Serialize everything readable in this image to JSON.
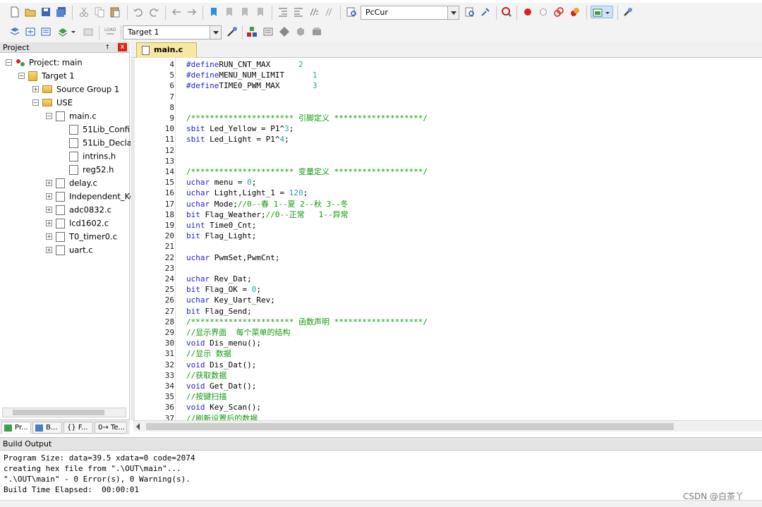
{
  "toolbar1": {
    "target_combo": "PcCur",
    "icons": [
      "new-file-icon",
      "open-file-icon",
      "save-icon",
      "save-all-icon",
      "cut-icon",
      "copy-icon",
      "paste-icon",
      "undo-icon",
      "redo-icon",
      "navigate-back-icon",
      "navigate-forward-icon",
      "bookmark-icon",
      "prev-bookmark-icon",
      "next-bookmark-icon",
      "clear-bookmarks-icon",
      "indent-icon",
      "unindent-icon",
      "comment-icon",
      "uncomment-icon",
      "find-in-files-icon",
      "find-icon",
      "incremental-find-icon",
      "debug-icon",
      "breakpoint-icon",
      "disable-breakpoint-icon",
      "kill-breakpoints-icon",
      "kill-all-breakpoints-icon",
      "window-layout-icon",
      "configure-icon"
    ]
  },
  "toolbar2": {
    "target_select": "Target 1",
    "icons": [
      "translate-icon",
      "build-icon",
      "rebuild-icon",
      "batch-build-icon",
      "stop-build-icon",
      "download-icon",
      "options-for-target-icon",
      "manage-components-icon",
      "file-extensions-icon",
      "select-packs-icon",
      "pack-installer-icon"
    ]
  },
  "project_panel": {
    "title": "Project",
    "pin": "†",
    "close": "x",
    "tree": [
      {
        "label": "Project: main",
        "level": 0,
        "expander": "−",
        "icon": "project-icon"
      },
      {
        "label": "Target 1",
        "level": 1,
        "expander": "−",
        "icon": "target-icon"
      },
      {
        "label": "Source Group 1",
        "level": 2,
        "expander": "+",
        "icon": "folder-icon"
      },
      {
        "label": "USE",
        "level": 2,
        "expander": "−",
        "icon": "folder-icon"
      },
      {
        "label": "main.c",
        "level": 3,
        "expander": "−",
        "icon": "c-file-icon"
      },
      {
        "label": "51Lib_Confi",
        "level": 4,
        "expander": "",
        "icon": "header-file-icon"
      },
      {
        "label": "51Lib_Decla",
        "level": 4,
        "expander": "",
        "icon": "header-file-icon"
      },
      {
        "label": "intrins.h",
        "level": 4,
        "expander": "",
        "icon": "header-file-icon"
      },
      {
        "label": "reg52.h",
        "level": 4,
        "expander": "",
        "icon": "header-file-icon"
      },
      {
        "label": "delay.c",
        "level": 3,
        "expander": "+",
        "icon": "c-file-icon"
      },
      {
        "label": "Independent_Ke",
        "level": 3,
        "expander": "+",
        "icon": "c-file-icon"
      },
      {
        "label": "adc0832.c",
        "level": 3,
        "expander": "+",
        "icon": "c-file-icon"
      },
      {
        "label": "lcd1602.c",
        "level": 3,
        "expander": "+",
        "icon": "c-file-icon"
      },
      {
        "label": "T0_timer0.c",
        "level": 3,
        "expander": "+",
        "icon": "c-file-icon"
      },
      {
        "label": "uart.c",
        "level": 3,
        "expander": "+",
        "icon": "c-file-icon"
      }
    ],
    "tabs": [
      "Pr...",
      "B...",
      "{} F...",
      "0→ Te..."
    ]
  },
  "editor": {
    "tab_label": "main.c",
    "lines": [
      {
        "n": "4",
        "parts": [
          [
            "kw",
            "#define"
          ],
          [
            "",
            "RUN_CNT_MAX      "
          ],
          [
            "num",
            "2"
          ]
        ]
      },
      {
        "n": "5",
        "parts": [
          [
            "kw",
            "#define"
          ],
          [
            "",
            "MENU_NUM_LIMIT      "
          ],
          [
            "num",
            "1"
          ]
        ]
      },
      {
        "n": "6",
        "parts": [
          [
            "kw",
            "#define"
          ],
          [
            "",
            "TIME0_PWM_MAX       "
          ],
          [
            "num",
            "3"
          ]
        ]
      },
      {
        "n": "7",
        "parts": []
      },
      {
        "n": "8",
        "parts": []
      },
      {
        "n": "9",
        "parts": [
          [
            "cm",
            "/********************** 引脚定义 *******************/"
          ]
        ]
      },
      {
        "n": "10",
        "parts": [
          [
            "kw",
            "sbit"
          ],
          [
            "",
            " Led_Yellow = P1^"
          ],
          [
            "num",
            "3"
          ],
          [
            "",
            ";"
          ]
        ]
      },
      {
        "n": "11",
        "parts": [
          [
            "kw",
            "sbit"
          ],
          [
            "",
            " Led_Light = P1^"
          ],
          [
            "num",
            "4"
          ],
          [
            "",
            ";"
          ]
        ]
      },
      {
        "n": "12",
        "parts": []
      },
      {
        "n": "13",
        "parts": []
      },
      {
        "n": "14",
        "parts": [
          [
            "cm",
            "/********************** 变量定义 *******************/"
          ]
        ]
      },
      {
        "n": "15",
        "parts": [
          [
            "kw",
            "uchar"
          ],
          [
            "",
            " menu = "
          ],
          [
            "num",
            "0"
          ],
          [
            "",
            ";"
          ]
        ]
      },
      {
        "n": "16",
        "parts": [
          [
            "kw",
            "uchar"
          ],
          [
            "",
            " Light,Light_1 = "
          ],
          [
            "num",
            "120"
          ],
          [
            "",
            ";"
          ]
        ]
      },
      {
        "n": "17",
        "parts": [
          [
            "kw",
            "uchar"
          ],
          [
            "",
            " Mode;"
          ],
          [
            "cm",
            "//0--春 1--夏 2--秋 3--冬"
          ]
        ]
      },
      {
        "n": "18",
        "parts": [
          [
            "kw",
            "bit"
          ],
          [
            "",
            " Flag_Weather;"
          ],
          [
            "cm",
            "//0--正常   1--异常"
          ]
        ]
      },
      {
        "n": "19",
        "parts": [
          [
            "kw",
            "uint"
          ],
          [
            "",
            " Time0_Cnt;"
          ]
        ]
      },
      {
        "n": "20",
        "parts": [
          [
            "kw",
            "bit"
          ],
          [
            "",
            " Flag_Light;"
          ]
        ]
      },
      {
        "n": "21",
        "parts": []
      },
      {
        "n": "22",
        "parts": [
          [
            "kw",
            "uchar"
          ],
          [
            "",
            " PwmSet,PwmCnt;"
          ]
        ]
      },
      {
        "n": "23",
        "parts": []
      },
      {
        "n": "24",
        "parts": [
          [
            "kw",
            "uchar"
          ],
          [
            "",
            " Rev_Dat;"
          ]
        ]
      },
      {
        "n": "25",
        "parts": [
          [
            "kw",
            "bit"
          ],
          [
            "",
            " Flag_OK = "
          ],
          [
            "num",
            "0"
          ],
          [
            "",
            ";"
          ]
        ]
      },
      {
        "n": "26",
        "parts": [
          [
            "kw",
            "uchar"
          ],
          [
            "",
            " Key_Uart_Rev;"
          ]
        ]
      },
      {
        "n": "27",
        "parts": [
          [
            "kw",
            "bit"
          ],
          [
            "",
            " Flag_Send;"
          ]
        ]
      },
      {
        "n": "28",
        "parts": [
          [
            "cm",
            "/********************** 函数声明 *******************/"
          ]
        ]
      },
      {
        "n": "29",
        "parts": [
          [
            "cm",
            "//显示界面  每个菜单的结构"
          ]
        ]
      },
      {
        "n": "30",
        "parts": [
          [
            "kw",
            "void"
          ],
          [
            "",
            " Dis_menu();"
          ]
        ]
      },
      {
        "n": "31",
        "parts": [
          [
            "cm",
            "//显示 数据"
          ]
        ]
      },
      {
        "n": "32",
        "parts": [
          [
            "kw",
            "void"
          ],
          [
            "",
            " Dis_Dat();"
          ]
        ]
      },
      {
        "n": "33",
        "parts": [
          [
            "cm",
            "//获取数据"
          ]
        ]
      },
      {
        "n": "34",
        "parts": [
          [
            "kw",
            "void"
          ],
          [
            "",
            " Get_Dat();"
          ]
        ]
      },
      {
        "n": "35",
        "parts": [
          [
            "cm",
            "//按键扫描"
          ]
        ]
      },
      {
        "n": "36",
        "parts": [
          [
            "kw",
            "void"
          ],
          [
            "",
            " Key_Scan();"
          ]
        ]
      },
      {
        "n": "37",
        "parts": [
          [
            "cm",
            "//刷新设置后的数据"
          ]
        ]
      }
    ]
  },
  "build_output": {
    "title": "Build Output",
    "lines": [
      "Program Size: data=39.5 xdata=0 code=2074",
      "creating hex file from \".\\OUT\\main\"...",
      "\".\\OUT\\main\" - 0 Error(s), 0 Warning(s).",
      "Build Time Elapsed:  00:00:01"
    ]
  },
  "watermark": "CSDN @白茶丫",
  "colors": {
    "keyword": "#2222cc",
    "comment": "#119911",
    "number": "#3399aa",
    "tab": "#f7e7a5"
  }
}
